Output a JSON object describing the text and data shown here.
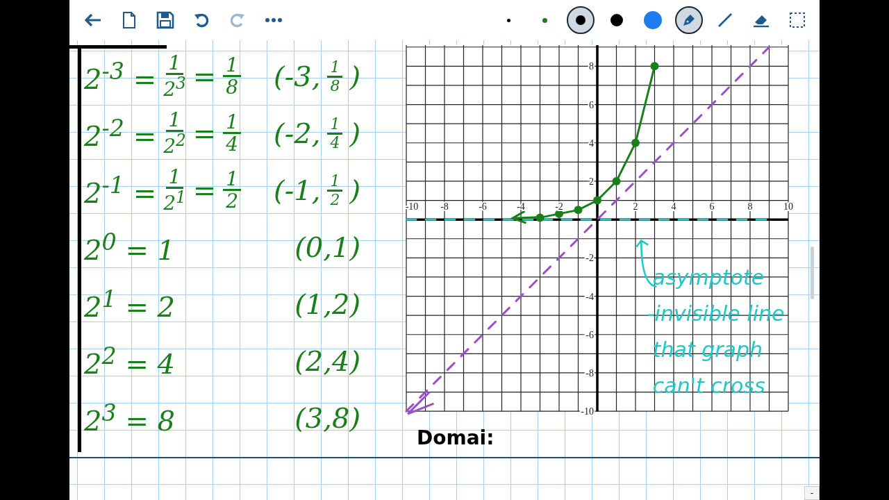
{
  "toolbar": {
    "left": [
      {
        "kind": "back",
        "disabled": false
      },
      {
        "kind": "new-page",
        "disabled": false
      },
      {
        "kind": "save",
        "disabled": false
      },
      {
        "kind": "undo",
        "disabled": false
      },
      {
        "kind": "redo",
        "disabled": true
      },
      {
        "kind": "more",
        "disabled": false
      }
    ],
    "right": [
      {
        "kind": "dot-tiny",
        "color": "#000000",
        "selected": false
      },
      {
        "kind": "dot-small",
        "color": "#1a7f1a",
        "selected": false
      },
      {
        "kind": "dot-medium",
        "color": "#000000",
        "selected": true
      },
      {
        "kind": "dot-large",
        "color": "#000000",
        "selected": false
      },
      {
        "kind": "dot-xlarge",
        "color": "#1e7bf0",
        "selected": false
      },
      {
        "kind": "pen",
        "selected": true
      },
      {
        "kind": "line",
        "selected": false
      },
      {
        "kind": "eraser",
        "selected": false
      },
      {
        "kind": "select",
        "selected": false
      }
    ]
  },
  "table_rows": [
    {
      "expression": [
        {
          "kind": "text",
          "text": "2$^{-3}$ ="
        },
        {
          "kind": "fraction",
          "num": "1",
          "den": "2$^{3}$"
        },
        {
          "kind": "text",
          "text": "="
        },
        {
          "kind": "fraction",
          "num": "1",
          "den": "8"
        }
      ],
      "point": [
        {
          "kind": "text",
          "text": "(-3,"
        },
        {
          "kind": "fraction",
          "num": "1",
          "den": "8"
        },
        {
          "kind": "text",
          "text": ")"
        }
      ]
    },
    {
      "expression": [
        {
          "kind": "text",
          "text": "2$^{-2}$ ="
        },
        {
          "kind": "fraction",
          "num": "1",
          "den": "2$^{2}$"
        },
        {
          "kind": "text",
          "text": "="
        },
        {
          "kind": "fraction",
          "num": "1",
          "den": "4"
        }
      ],
      "point": [
        {
          "kind": "text",
          "text": "(-2,"
        },
        {
          "kind": "fraction",
          "num": "1",
          "den": "4"
        },
        {
          "kind": "text",
          "text": ")"
        }
      ]
    },
    {
      "expression": [
        {
          "kind": "text",
          "text": "2$^{-1}$ ="
        },
        {
          "kind": "fraction",
          "num": "1",
          "den": "2$^{1}$"
        },
        {
          "kind": "text",
          "text": "="
        },
        {
          "kind": "fraction",
          "num": "1",
          "den": "2"
        }
      ],
      "point": [
        {
          "kind": "text",
          "text": "(-1,"
        },
        {
          "kind": "fraction",
          "num": "1",
          "den": "2"
        },
        {
          "kind": "text",
          "text": ")"
        }
      ]
    },
    {
      "expression": [
        {
          "kind": "text",
          "text": "2$^{0}$ = 1"
        }
      ],
      "point": [
        {
          "kind": "text",
          "text": "(0,1)"
        }
      ]
    },
    {
      "expression": [
        {
          "kind": "text",
          "text": "2$^{1}$ = 2"
        }
      ],
      "point": [
        {
          "kind": "text",
          "text": "(1,2)"
        }
      ]
    },
    {
      "expression": [
        {
          "kind": "text",
          "text": "2$^{2}$ = 4"
        }
      ],
      "point": [
        {
          "kind": "text",
          "text": "(2,4)"
        }
      ]
    },
    {
      "expression": [
        {
          "kind": "text",
          "text": "2$^{3}$ = 8"
        }
      ],
      "point": [
        {
          "kind": "text",
          "text": "(3,8)"
        }
      ]
    }
  ],
  "graph": {
    "chart_data": {
      "type": "line",
      "x": [
        -10,
        -3,
        -2,
        -1,
        0,
        1,
        2,
        3,
        9
      ],
      "xlim": [
        -10,
        10
      ],
      "ylim": [
        -10,
        9
      ],
      "grid": true,
      "xticks": [
        -10,
        -8,
        -6,
        -4,
        -2,
        2,
        4,
        6,
        8,
        10
      ],
      "yticks": [
        -10,
        -8,
        -6,
        -4,
        -2,
        2,
        4,
        6,
        8
      ],
      "series": [
        {
          "color": "#1ec8c8",
          "line_style": "dashed",
          "marker": "none",
          "values": [
            0,
            0,
            0,
            0,
            0,
            0,
            0,
            0,
            0
          ]
        },
        {
          "color": "#9a4fc8",
          "line_style": "dashed",
          "marker": "none",
          "values": [
            -10,
            -3,
            -2,
            -1,
            0,
            1,
            2,
            3,
            9
          ]
        },
        {
          "color": "#1a7f1a",
          "line_style": "solid",
          "marker": "circle",
          "values": [
            null,
            0.1,
            0.3,
            0.5,
            1,
            2,
            4,
            8,
            null
          ]
        }
      ],
      "annotations": [
        {
          "text": "asymptote"
        },
        {
          "text": "-invisible line"
        },
        {
          "text": "that graph"
        },
        {
          "text": "can't cross"
        }
      ]
    }
  },
  "domain_label": "Domai:",
  "zoom_out": "-"
}
